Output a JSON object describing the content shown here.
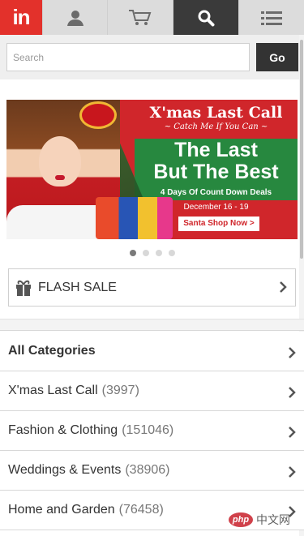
{
  "nav": {
    "logo": "in",
    "icons": [
      "user-icon",
      "cart-icon",
      "search-icon",
      "menu-icon"
    ],
    "accent": "#e3312b",
    "active_bg": "#3a3a3a"
  },
  "search": {
    "placeholder": "Search",
    "value": "",
    "go_label": "Go"
  },
  "banner": {
    "title": "X'mas Last Call",
    "subtitle": "~ Catch Me If You Can ~",
    "headline_1": "The Last",
    "headline_2": "But The Best",
    "tagline": "4 Days Of Count Down Deals",
    "dates": "December 16 - 19",
    "cta": "Santa Shop Now >",
    "slides_total": 4,
    "slide_active": 1
  },
  "flash_sale": {
    "label": "FLASH SALE"
  },
  "categories": [
    {
      "label": "All Categories",
      "count": ""
    },
    {
      "label": "X'mas Last Call",
      "count": "(3997)"
    },
    {
      "label": "Fashion & Clothing",
      "count": "(151046)"
    },
    {
      "label": "Weddings & Events",
      "count": "(38906)"
    },
    {
      "label": "Home and Garden",
      "count": "(76458)"
    }
  ],
  "watermark": {
    "brand": "php",
    "site": "中文网"
  }
}
